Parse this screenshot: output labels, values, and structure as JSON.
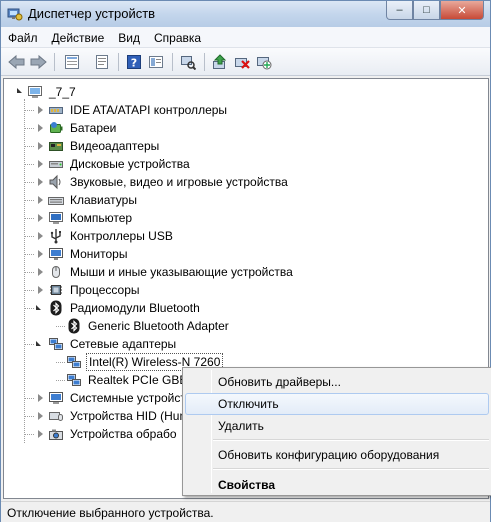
{
  "window": {
    "title": "Диспетчер устройств",
    "controls": {
      "minimize": "–",
      "maximize": "□",
      "close": "✕"
    }
  },
  "menubar": {
    "items": [
      "Файл",
      "Действие",
      "Вид",
      "Справка"
    ]
  },
  "toolbar": {
    "buttons": [
      "back-icon",
      "forward-icon",
      "tree-view-icon",
      "properties-icon",
      "help-icon",
      "panel-icon",
      "scan-hardware-icon",
      "update-driver-icon",
      "uninstall-icon",
      "disable-icon"
    ]
  },
  "tree": {
    "root": "_7_7",
    "categories": [
      {
        "label": "IDE ATA/ATAPI контроллеры",
        "icon": "ide-controller-icon",
        "expanded": false
      },
      {
        "label": "Батареи",
        "icon": "battery-icon",
        "expanded": false
      },
      {
        "label": "Видеоадаптеры",
        "icon": "display-adapter-icon",
        "expanded": false
      },
      {
        "label": "Дисковые устройства",
        "icon": "disk-drive-icon",
        "expanded": false
      },
      {
        "label": "Звуковые, видео и игровые устройства",
        "icon": "sound-icon",
        "expanded": false
      },
      {
        "label": "Клавиатуры",
        "icon": "keyboard-icon",
        "expanded": false
      },
      {
        "label": "Компьютер",
        "icon": "computer-icon",
        "expanded": false
      },
      {
        "label": "Контроллеры USB",
        "icon": "usb-icon",
        "expanded": false
      },
      {
        "label": "Мониторы",
        "icon": "monitor-icon",
        "expanded": false
      },
      {
        "label": "Мыши и иные указывающие устройства",
        "icon": "mouse-icon",
        "expanded": false
      },
      {
        "label": "Процессоры",
        "icon": "processor-icon",
        "expanded": false
      },
      {
        "label": "Радиомодули Bluetooth",
        "icon": "bluetooth-icon",
        "expanded": true,
        "children": [
          "Generic Bluetooth Adapter"
        ]
      },
      {
        "label": "Сетевые адаптеры",
        "icon": "network-adapter-icon",
        "expanded": true,
        "children": [
          "Intel(R) Wireless-N 7260",
          "Realtek PCIe GBE F"
        ]
      },
      {
        "label": "Системные устройст",
        "icon": "system-device-icon",
        "expanded": false
      },
      {
        "label": "Устройства HID (Hun",
        "icon": "hid-icon",
        "expanded": false
      },
      {
        "label": "Устройства обрабо",
        "icon": "imaging-icon",
        "expanded": false
      }
    ],
    "selected": "Intel(R) Wireless-N 7260"
  },
  "context_menu": {
    "items": [
      {
        "label": "Обновить драйверы...",
        "highlighted": false,
        "bold": false
      },
      {
        "label": "Отключить",
        "highlighted": true,
        "bold": false
      },
      {
        "label": "Удалить",
        "highlighted": false,
        "bold": false
      },
      {
        "label": "Обновить конфигурацию оборудования",
        "highlighted": false,
        "bold": false
      },
      {
        "label": "Свойства",
        "highlighted": false,
        "bold": true
      }
    ]
  },
  "status_bar": {
    "text": "Отключение выбранного устройства."
  }
}
